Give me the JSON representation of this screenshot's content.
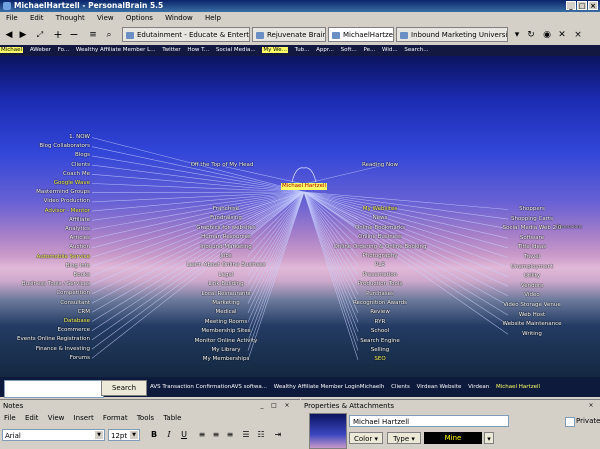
{
  "window": {
    "title": "MichaelHartzell - PersonalBrain 5.5"
  },
  "menu": [
    "File",
    "Edit",
    "Thought",
    "View",
    "Options",
    "Window",
    "Help"
  ],
  "tabs": [
    {
      "label": "Edutainment - Educate & Entertain",
      "active": false
    },
    {
      "label": "Rejuvenate Brain",
      "active": false
    },
    {
      "label": "MichaelHartzell",
      "active": true
    },
    {
      "label": "Inbound Marketing University",
      "active": false
    }
  ],
  "pins": [
    "Michael",
    "AWeber",
    "Fo...",
    "Wealthy Affiliate Member L...",
    "Twitter",
    "How T...",
    "Social Media...",
    "My We...",
    "Tub...",
    "Appr...",
    "Soft...",
    "Pe...",
    "Wid...",
    "Search..."
  ],
  "plex": {
    "center": "Michael Hartzell",
    "parents": [
      "Off the Top of My Head",
      "Reading Now"
    ],
    "left_column": [
      "1. NOW",
      "Blog Collaborators",
      "Blogs",
      "Clients",
      "Coach Me",
      "Google Wave",
      "Mastermind Groups",
      "Video Production",
      "Advisor - Mentor",
      "Affiliate",
      "Analytics",
      "Articles",
      "Auction",
      "Automobile Service",
      "Blog Info",
      "Books",
      "Business Tools / Services",
      "Competition",
      "Consultant",
      "CRM",
      "Database",
      "Ecommerce",
      "Events Online Registration",
      "Finance & Investing",
      "Forums"
    ],
    "middle_column": [
      "Franchise",
      "Fundraising",
      "Graphics for websites",
      "Human Resources",
      "Inbound Marketing",
      "Jobs",
      "Learn About Online Business",
      "Legal",
      "Link Building",
      "Local Restaurants",
      "Marketing",
      "Medical",
      "Meeting Rooms",
      "Membership Sites",
      "Monitor Online Activity",
      "My Library",
      "My Memberships"
    ],
    "right_column": [
      "My Websites",
      "News",
      "Online Bookmarks",
      "Online Business",
      "Online Ordering & Online Booking",
      "Photography",
      "PLR",
      "Presentation",
      "Production Tools",
      "Purchases",
      "Recognition Awards",
      "Review",
      "RYR",
      "School",
      "Search Engine",
      "Selling",
      "SEO"
    ],
    "far_right_column": [
      "Shoppers",
      "Shopping Carts",
      "Social Media Web 2.0",
      "Software",
      "Title Ideas",
      "Travel",
      "Unemployment",
      "Utility",
      "Vendors",
      "Video",
      "Video Storage Venue",
      "Web Host",
      "Website Maintenance",
      "Writing"
    ],
    "far_right_extra": "Dimensions"
  },
  "search": {
    "placeholder": "",
    "button": "Search"
  },
  "recent": [
    "AVS Transaction ConfirmationAVS softwa...",
    "Wealthy Affiliate Member LoginMichaelh",
    "Clients",
    "Virdean Website",
    "Virdean",
    "Michael Hartzell"
  ],
  "notes": {
    "title": "Notes",
    "menu": [
      "File",
      "Edit",
      "View",
      "Insert",
      "Format",
      "Tools",
      "Table"
    ],
    "font": "Arial",
    "size": "12pt",
    "format_buttons": [
      "B",
      "I",
      "U"
    ]
  },
  "properties": {
    "title": "Properties & Attachments",
    "name": "Michael Hartzell",
    "private_label": "Private",
    "color_label": "Color",
    "type_label": "Type",
    "mine_label": "Mine"
  },
  "colors": {
    "highlight": "#ffff66",
    "titlebar": "#0a246a"
  }
}
